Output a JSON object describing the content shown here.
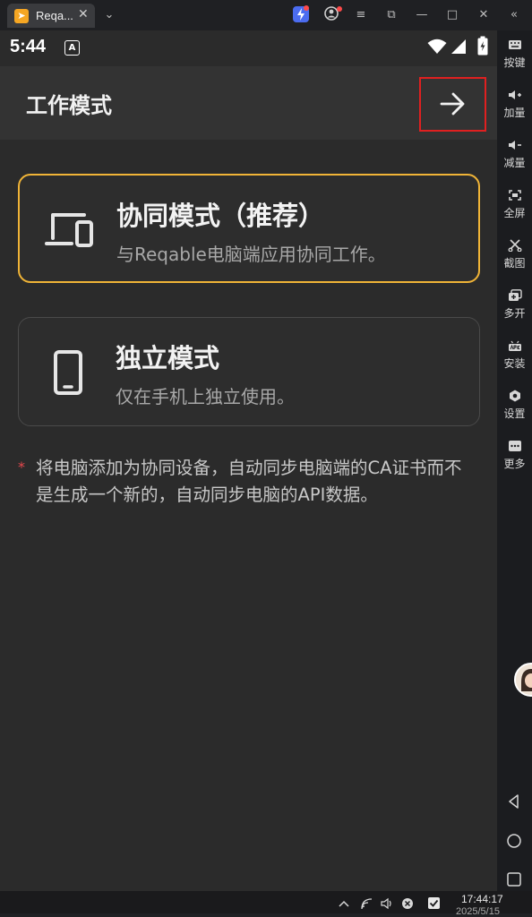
{
  "window": {
    "tab_title": "Reqa...",
    "tab_close": "✕",
    "tab_dropdown": "⌄",
    "controls": [
      "≡",
      "⧉",
      "—",
      "□",
      "✕",
      "«"
    ]
  },
  "statusbar": {
    "time": "5:44",
    "notif_icon_label": "A"
  },
  "appbar": {
    "title": "工作模式"
  },
  "modes": [
    {
      "title": "协同模式（推荐）",
      "description": "与Reqable电脑端应用协同工作。",
      "selected": true
    },
    {
      "title": "独立模式",
      "description": "仅在手机上独立使用。",
      "selected": false
    }
  ],
  "note": {
    "star": "*",
    "text": "将电脑添加为协同设备，自动同步电脑端的CA证书而不是生成一个新的，自动同步电脑的API数据。"
  },
  "sidebar": {
    "items": [
      {
        "label": "按键",
        "icon": "keyboard-icon"
      },
      {
        "label": "加量",
        "icon": "volume-up-icon"
      },
      {
        "label": "减量",
        "icon": "volume-down-icon"
      },
      {
        "label": "全屏",
        "icon": "fullscreen-icon"
      },
      {
        "label": "截图",
        "icon": "scissors-icon"
      },
      {
        "label": "多开",
        "icon": "multi-instance-icon"
      },
      {
        "label": "安装",
        "icon": "apk-install-icon"
      },
      {
        "label": "设置",
        "icon": "gear-icon"
      },
      {
        "label": "更多",
        "icon": "more-icon"
      }
    ]
  },
  "taskbar": {
    "time": "17:44:17",
    "date": "2025/5/15"
  },
  "colors": {
    "accent_selected_border": "#f0b437",
    "highlight_box": "#e02020",
    "background": "#2b2b2b"
  }
}
